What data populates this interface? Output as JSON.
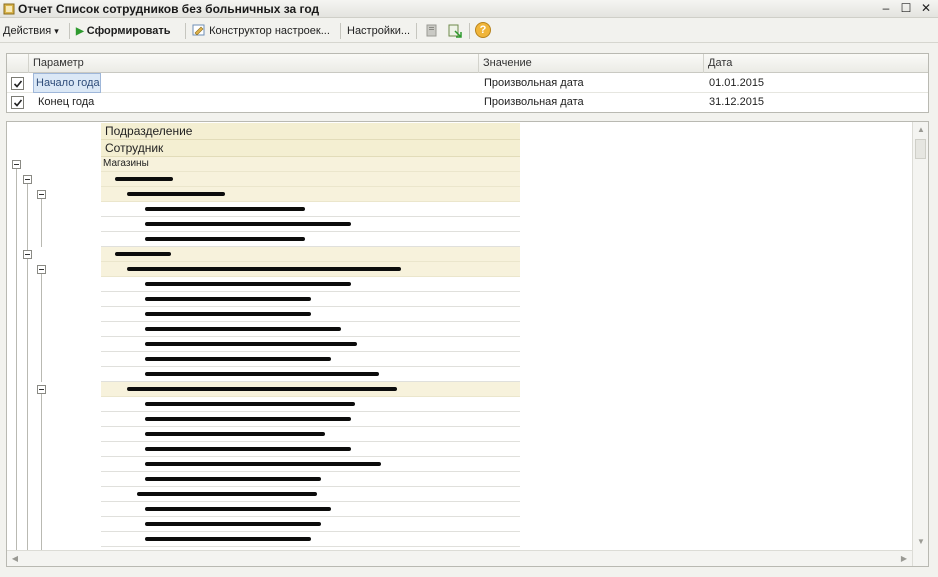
{
  "window": {
    "title": "Отчет  Список сотрудников без больничных за год",
    "minimize_glyph": "–",
    "maximize_glyph": "☐",
    "close_glyph": "✕"
  },
  "toolbar": {
    "actions_label": "Действия",
    "actions_arrow": "▾",
    "generate_icon": "▶",
    "generate_label": "Сформировать",
    "constructor_label": "Конструктор настроек...",
    "settings_label": "Настройки...",
    "help_glyph": "?"
  },
  "parameters": {
    "columns": [
      "Параметр",
      "Значение",
      "Дата"
    ],
    "rows": [
      {
        "checked": true,
        "name": "Начало года",
        "value": "Произвольная дата",
        "date": "01.01.2015"
      },
      {
        "checked": true,
        "name": "Конец года",
        "value": "Произвольная дата",
        "date": "31.12.2015"
      }
    ]
  },
  "report": {
    "headers": [
      "Подразделение",
      "Сотрудник"
    ],
    "root_label": "Магазины"
  },
  "colors": {
    "group_row": "#f7f2dc",
    "header_bg": "#f4efd2",
    "selection": "#dbe8f6",
    "generate_green": "#2e9a2e"
  }
}
